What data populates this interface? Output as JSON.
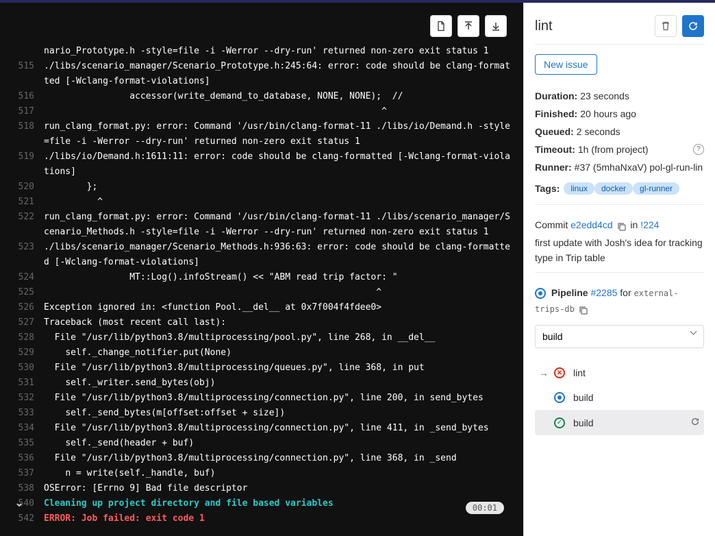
{
  "header": {
    "title": "lint",
    "new_issue_label": "New issue"
  },
  "toolbar": {
    "show_raw_title": "Show complete raw",
    "scroll_top_title": "Scroll to top",
    "scroll_bottom_title": "Scroll to bottom"
  },
  "meta": {
    "duration_label": "Duration:",
    "duration_value": "23 seconds",
    "finished_label": "Finished:",
    "finished_value": "20 hours ago",
    "queued_label": "Queued:",
    "queued_value": "2 seconds",
    "timeout_label": "Timeout:",
    "timeout_value": "1h (from project)",
    "runner_label": "Runner:",
    "runner_value": "#37 (5mhaNxaV) pol-gl-run-lin",
    "tags_label": "Tags:",
    "tags": [
      "linux",
      "docker",
      "gl-runner"
    ]
  },
  "commit": {
    "label": "Commit",
    "sha": "e2edd4cd",
    "in_label": "in",
    "mr_ref": "!224",
    "message": "first update with Josh's idea for tracking type in Trip table"
  },
  "pipeline": {
    "label": "Pipeline",
    "id": "#2285",
    "for_label": "for",
    "branch": "external-trips-db",
    "stage_selected": "build"
  },
  "jobs": {
    "current": "lint",
    "list": [
      {
        "name": "build",
        "status": "running",
        "active": false
      },
      {
        "name": "build",
        "status": "passed",
        "active": true
      }
    ]
  },
  "log": {
    "section_time": "00:01",
    "lines": [
      {
        "n": "",
        "t": "nario_Prototype.h -style=file -i -Werror --dry-run' returned non-zero exit status 1",
        "cls": ""
      },
      {
        "n": "515",
        "t": "./libs/scenario_manager/Scenario_Prototype.h:245:64: error: code should be clang-formatted [-Wclang-format-violations]",
        "cls": ""
      },
      {
        "n": "516",
        "t": "                accessor(write_demand_to_database, NONE, NONE);  //",
        "cls": ""
      },
      {
        "n": "517",
        "t": "                                                               ^",
        "cls": ""
      },
      {
        "n": "518",
        "t": "run_clang_format.py: error: Command '/usr/bin/clang-format-11 ./libs/io/Demand.h -style=file -i -Werror --dry-run' returned non-zero exit status 1",
        "cls": ""
      },
      {
        "n": "519",
        "t": "./libs/io/Demand.h:1611:11: error: code should be clang-formatted [-Wclang-format-violations]",
        "cls": ""
      },
      {
        "n": "520",
        "t": "        };",
        "cls": ""
      },
      {
        "n": "521",
        "t": "          ^",
        "cls": ""
      },
      {
        "n": "522",
        "t": "run_clang_format.py: error: Command '/usr/bin/clang-format-11 ./libs/scenario_manager/Scenario_Methods.h -style=file -i -Werror --dry-run' returned non-zero exit status 1",
        "cls": ""
      },
      {
        "n": "523",
        "t": "./libs/scenario_manager/Scenario_Methods.h:936:63: error: code should be clang-formatted [-Wclang-format-violations]",
        "cls": ""
      },
      {
        "n": "524",
        "t": "                MT::Log().infoStream() << \"ABM read trip factor: \"",
        "cls": ""
      },
      {
        "n": "525",
        "t": "                                                              ^",
        "cls": ""
      },
      {
        "n": "526",
        "t": "Exception ignored in: <function Pool.__del__ at 0x7f004f4fdee0>",
        "cls": ""
      },
      {
        "n": "527",
        "t": "Traceback (most recent call last):",
        "cls": ""
      },
      {
        "n": "528",
        "t": "  File \"/usr/lib/python3.8/multiprocessing/pool.py\", line 268, in __del__",
        "cls": ""
      },
      {
        "n": "529",
        "t": "    self._change_notifier.put(None)",
        "cls": ""
      },
      {
        "n": "530",
        "t": "  File \"/usr/lib/python3.8/multiprocessing/queues.py\", line 368, in put",
        "cls": ""
      },
      {
        "n": "531",
        "t": "    self._writer.send_bytes(obj)",
        "cls": ""
      },
      {
        "n": "532",
        "t": "  File \"/usr/lib/python3.8/multiprocessing/connection.py\", line 200, in send_bytes",
        "cls": ""
      },
      {
        "n": "533",
        "t": "    self._send_bytes(m[offset:offset + size])",
        "cls": ""
      },
      {
        "n": "534",
        "t": "  File \"/usr/lib/python3.8/multiprocessing/connection.py\", line 411, in _send_bytes",
        "cls": ""
      },
      {
        "n": "535",
        "t": "    self._send(header + buf)",
        "cls": ""
      },
      {
        "n": "536",
        "t": "  File \"/usr/lib/python3.8/multiprocessing/connection.py\", line 368, in _send",
        "cls": ""
      },
      {
        "n": "537",
        "t": "    n = write(self._handle, buf)",
        "cls": ""
      },
      {
        "n": "538",
        "t": "OSError: [Errno 9] Bad file descriptor",
        "cls": ""
      },
      {
        "n": "540",
        "t": "Cleaning up project directory and file based variables",
        "cls": "cyan"
      },
      {
        "n": "542",
        "t": "ERROR: Job failed: exit code 1",
        "cls": "red"
      }
    ]
  }
}
